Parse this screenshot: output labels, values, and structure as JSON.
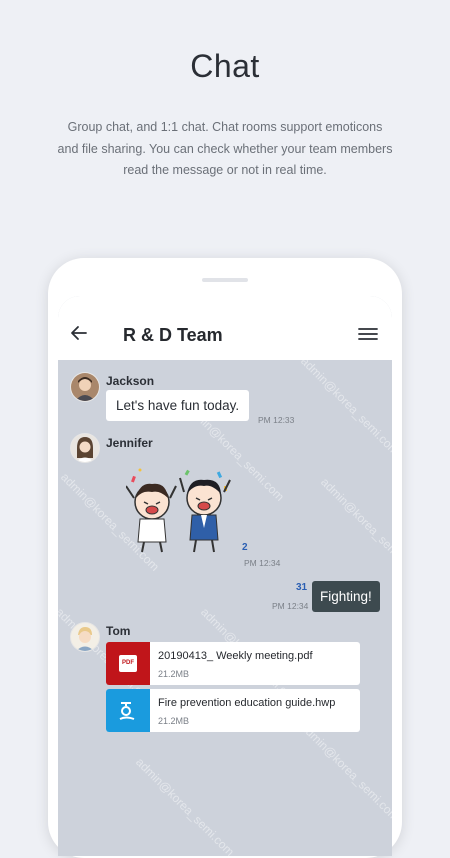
{
  "promo": {
    "title": "Chat",
    "description_lines": [
      "Group chat, and 1:1 chat. Chat rooms support emoticons",
      "and file sharing. You can check whether your team members",
      "read the message or not in real time."
    ]
  },
  "chat": {
    "room_title": "R & D Team",
    "watermark_text": "admin@korea_semi.com",
    "messages": [
      {
        "sender": "Jackson",
        "text": "Let's have fun today.",
        "time": "PM 12:33"
      },
      {
        "sender": "Jennifer",
        "emoticon": "two-cheering-characters",
        "unread": "2",
        "time": "PM 12:34"
      },
      {
        "text": "Fighting!",
        "unread": "31",
        "time": "PM 12:34"
      },
      {
        "sender": "Tom"
      }
    ],
    "files": [
      {
        "name": "20190413_ Weekly meeting.pdf",
        "size": "21.2MB",
        "type_label": "PDF",
        "icon": "pdf-icon",
        "color": "#c0151a"
      },
      {
        "name": "Fire prevention education guide.hwp",
        "size": "21.2MB",
        "icon": "hwp-icon",
        "color": "#1a9bde"
      }
    ]
  },
  "colors": {
    "chat_background": "#cdd2db",
    "sent_bubble": "#3d4a4f",
    "unread_count": "#2b5fb3",
    "pdf_icon": "#c0151a",
    "hwp_icon": "#1a9bde"
  }
}
